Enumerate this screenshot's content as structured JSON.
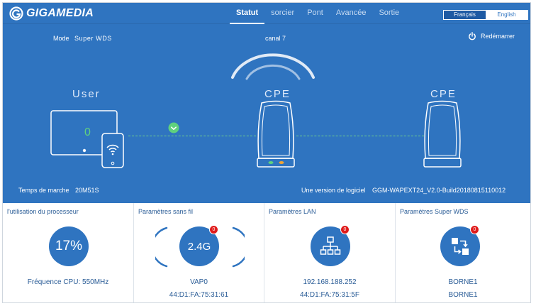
{
  "header": {
    "logo_text": "GIGAMEDIA",
    "nav": [
      {
        "label": "Statut",
        "active": true
      },
      {
        "label": "sorcier",
        "active": false
      },
      {
        "label": "Pont",
        "active": false
      },
      {
        "label": "Avancée",
        "active": false
      },
      {
        "label": "Sortie",
        "active": false
      }
    ],
    "languages": [
      {
        "label": "Français",
        "active": true
      },
      {
        "label": "English",
        "active": false
      }
    ]
  },
  "status": {
    "mode_label": "Mode",
    "mode_value": "Super WDS",
    "channel": "canal 7",
    "reboot_label": "Redémarrer",
    "user_label": "User",
    "user_count": "0",
    "cpe_left": "CPE",
    "cpe_right": "CPE",
    "uptime_label": "Temps de marche",
    "uptime_value": "20M51S",
    "software_label": "Une version de logiciel",
    "software_value": "GGM-WAPEXT24_V2.0-Build20180815110012"
  },
  "panels": [
    {
      "title": "l'utilisation du processeur",
      "circle": "17%",
      "line1": "Fréquence CPU: 550MHz",
      "line2": ""
    },
    {
      "title": "Paramètres sans fil",
      "circle": "2.4G",
      "badge": "0",
      "line1": "VAP0",
      "line2": "44:D1:FA:75:31:61"
    },
    {
      "title": "Paramètres LAN",
      "badge": "0",
      "line1": "192.168.188.252",
      "line2": "44:D1:FA:75:31:5F"
    },
    {
      "title": "Paramètres Super WDS",
      "badge": "0",
      "line1": "BORNE1",
      "line2": "BORNE1"
    }
  ],
  "colors": {
    "accent": "#2f74c0",
    "badge": "#e01b1b",
    "link_ok": "#5fd17e"
  },
  "icons": [
    "gigamedia-logo-icon",
    "power-icon",
    "monitor-icon",
    "tablet-wifi-icon",
    "link-check-icon",
    "cpe-device-icon",
    "network-icon",
    "wds-icon"
  ]
}
